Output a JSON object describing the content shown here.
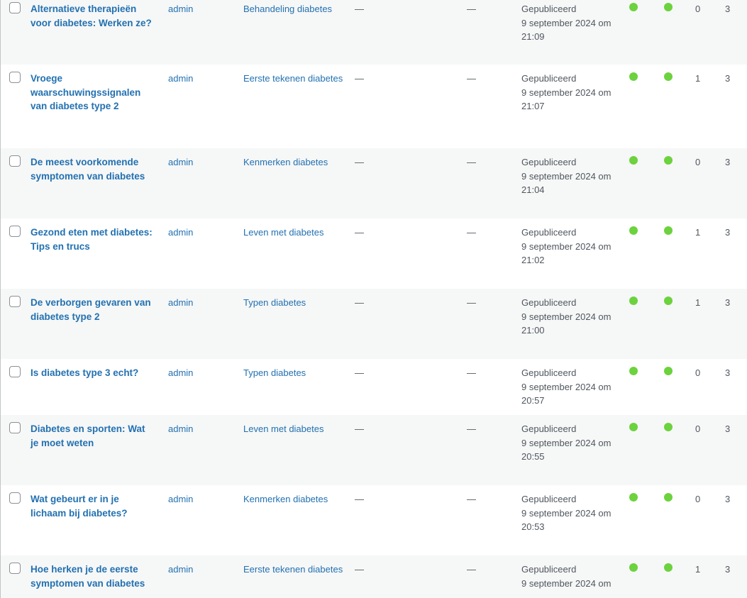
{
  "status_color": "#6cd23e",
  "link_color": "#2271b1",
  "posts": [
    {
      "title": "Alternatieve therapieën voor diabetes: Werken ze?",
      "author": "admin",
      "category": "Behandeling diabetes",
      "tags": "—",
      "comments": "—",
      "status": "Gepubliceerd",
      "date": "9 september 2024 om 21:09",
      "seo_status": "green",
      "readability_status": "green",
      "links_in": "0",
      "links_out": "3"
    },
    {
      "title": "Vroege waarschuwingssignalen van diabetes type 2",
      "author": "admin",
      "category": "Eerste tekenen diabetes",
      "tags": "—",
      "comments": "—",
      "status": "Gepubliceerd",
      "date": "9 september 2024 om 21:07",
      "seo_status": "green",
      "readability_status": "green",
      "links_in": "1",
      "links_out": "3"
    },
    {
      "title": "De meest voorkomende symptomen van diabetes",
      "author": "admin",
      "category": "Kenmerken diabetes",
      "tags": "—",
      "comments": "—",
      "status": "Gepubliceerd",
      "date": "9 september 2024 om 21:04",
      "seo_status": "green",
      "readability_status": "green",
      "links_in": "0",
      "links_out": "3"
    },
    {
      "title": "Gezond eten met diabetes: Tips en trucs",
      "author": "admin",
      "category": "Leven met diabetes",
      "tags": "—",
      "comments": "—",
      "status": "Gepubliceerd",
      "date": "9 september 2024 om 21:02",
      "seo_status": "green",
      "readability_status": "green",
      "links_in": "1",
      "links_out": "3"
    },
    {
      "title": "De verborgen gevaren van diabetes type 2",
      "author": "admin",
      "category": "Typen diabetes",
      "tags": "—",
      "comments": "—",
      "status": "Gepubliceerd",
      "date": "9 september 2024 om 21:00",
      "seo_status": "green",
      "readability_status": "green",
      "links_in": "1",
      "links_out": "3"
    },
    {
      "title": "Is diabetes type 3 echt?",
      "author": "admin",
      "category": "Typen diabetes",
      "tags": "—",
      "comments": "—",
      "status": "Gepubliceerd",
      "date": "9 september 2024 om 20:57",
      "seo_status": "green",
      "readability_status": "green",
      "links_in": "0",
      "links_out": "3"
    },
    {
      "title": "Diabetes en sporten: Wat je moet weten",
      "author": "admin",
      "category": "Leven met diabetes",
      "tags": "—",
      "comments": "—",
      "status": "Gepubliceerd",
      "date": "9 september 2024 om 20:55",
      "seo_status": "green",
      "readability_status": "green",
      "links_in": "0",
      "links_out": "3"
    },
    {
      "title": "Wat gebeurt er in je lichaam bij diabetes?",
      "author": "admin",
      "category": "Kenmerken diabetes",
      "tags": "—",
      "comments": "—",
      "status": "Gepubliceerd",
      "date": "9 september 2024 om 20:53",
      "seo_status": "green",
      "readability_status": "green",
      "links_in": "0",
      "links_out": "3"
    },
    {
      "title": "Hoe herken je de eerste symptomen van diabetes",
      "author": "admin",
      "category": "Eerste tekenen diabetes",
      "tags": "—",
      "comments": "—",
      "status": "Gepubliceerd",
      "date": "9 september 2024 om",
      "seo_status": "green",
      "readability_status": "green",
      "links_in": "1",
      "links_out": "3"
    }
  ]
}
